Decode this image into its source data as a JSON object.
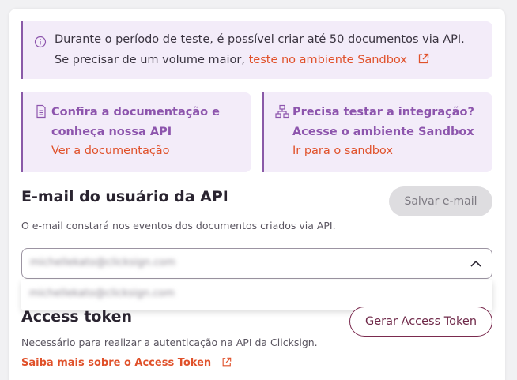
{
  "alert": {
    "line1": "Durante o período de teste, é possível criar até 50 documentos via API.",
    "line2_prefix": "Se precisar de um volume maior,",
    "line2_link": "teste no ambiente Sandbox"
  },
  "tiles": {
    "docs": {
      "title": "Confira a documentação e conheça nossa API",
      "link": "Ver a documentação"
    },
    "sandbox": {
      "title": "Precisa testar a integração? Acesse o ambiente Sandbox",
      "link": "Ir para o sandbox"
    }
  },
  "email_section": {
    "title": "E-mail do usuário da API",
    "save_button": "Salvar e-mail",
    "description": "O e-mail constará nos eventos dos documentos criados via API.",
    "selected_value": "michellekato@clicksign.com",
    "options": [
      "michellekato@clicksign.com"
    ]
  },
  "token_section": {
    "title": "Access token",
    "button": "Gerar Access Token",
    "description": "Necessário para realizar a autenticação na API da Clicksign.",
    "link": "Saiba mais sobre o Access Token"
  },
  "colors": {
    "accent_purple": "#8d55ad",
    "link_orange": "#e0512a",
    "panel_bg": "#f3ecf9",
    "button_border": "#7a2a4e"
  },
  "icons": [
    "info-icon",
    "external-link-icon",
    "document-icon",
    "hierarchy-icon",
    "chevron-up-icon"
  ]
}
